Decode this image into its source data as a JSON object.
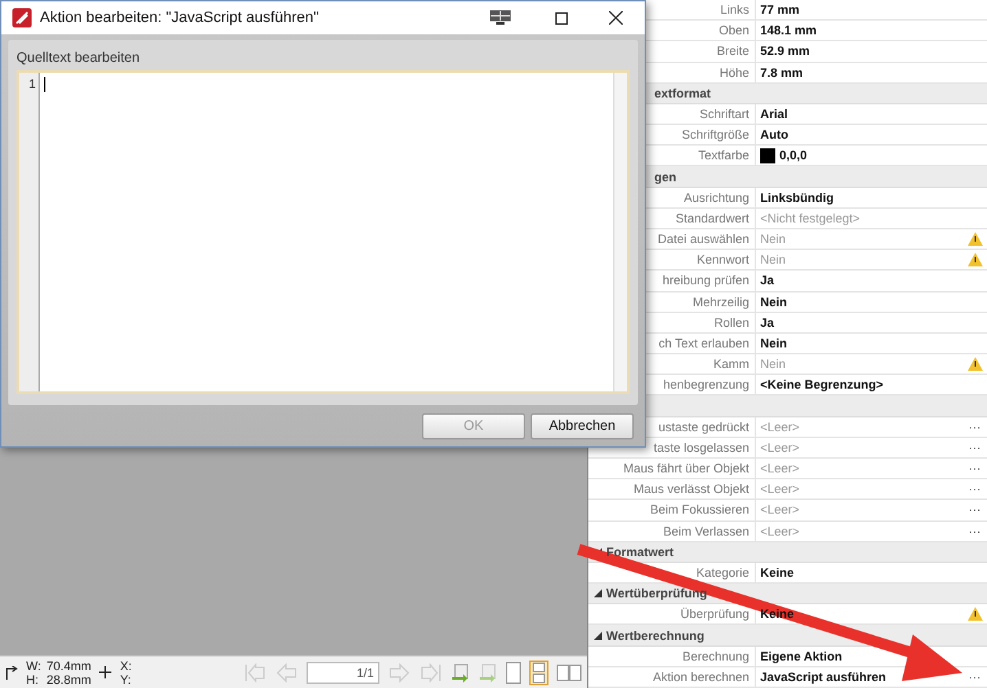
{
  "dialog": {
    "title": "Aktion bearbeiten: \"JavaScript ausführen\"",
    "editor_label": "Quelltext bearbeiten",
    "line_numbers": [
      "1"
    ],
    "buttons": [
      {
        "label": "OK",
        "disabled": true
      },
      {
        "label": "Abbrechen",
        "disabled": false
      }
    ]
  },
  "properties": [
    {
      "kind": "property",
      "label": "Links",
      "value": "77 mm",
      "dimmed": false,
      "warning": false
    },
    {
      "kind": "property",
      "label": "Oben",
      "value": "148.1 mm",
      "dimmed": false,
      "warning": false
    },
    {
      "kind": "property",
      "label": "Breite",
      "value": "52.9 mm",
      "dimmed": false,
      "warning": false
    },
    {
      "kind": "property",
      "label": "Höhe",
      "value": "7.8 mm",
      "dimmed": false,
      "warning": false
    },
    {
      "kind": "section",
      "title": "extformat"
    },
    {
      "kind": "property",
      "label": "Schriftart",
      "value": "Arial",
      "dimmed": false,
      "warning": false
    },
    {
      "kind": "property",
      "label": "Schriftgröße",
      "value": "Auto",
      "dimmed": false,
      "warning": false
    },
    {
      "kind": "property",
      "label": "Textfarbe",
      "value": "0,0,0",
      "color": "#000000",
      "dimmed": false,
      "warning": false
    },
    {
      "kind": "section",
      "title": "gen"
    },
    {
      "kind": "property",
      "label": "Ausrichtung",
      "value": "Linksbündig",
      "dimmed": false,
      "warning": false
    },
    {
      "kind": "property",
      "label": "Standardwert",
      "value": "<Nicht festgelegt>",
      "dimmed": true,
      "warning": false
    },
    {
      "kind": "property",
      "label": "Datei auswählen",
      "value": "Nein",
      "dimmed": true,
      "warning": true
    },
    {
      "kind": "property",
      "label": "Kennwort",
      "value": "Nein",
      "dimmed": true,
      "warning": true
    },
    {
      "kind": "property",
      "label": "hreibung prüfen",
      "value": "Ja",
      "dimmed": false,
      "warning": false
    },
    {
      "kind": "property",
      "label": "Mehrzeilig",
      "value": "Nein",
      "dimmed": false,
      "warning": false
    },
    {
      "kind": "property",
      "label": "Rollen",
      "value": "Ja",
      "dimmed": false,
      "warning": false
    },
    {
      "kind": "property",
      "label": "ch Text erlauben",
      "value": "Nein",
      "dimmed": false,
      "warning": false
    },
    {
      "kind": "property",
      "label": "Kamm",
      "value": "Nein",
      "dimmed": true,
      "warning": true
    },
    {
      "kind": "property",
      "label": "henbegrenzung",
      "value": "<Keine Begrenzung>",
      "dimmed": false,
      "warning": false
    },
    {
      "kind": "section"
    },
    {
      "kind": "property",
      "label": "ustaste gedrückt",
      "value": "<Leer>",
      "dimmed": true,
      "warning": false,
      "button": "···"
    },
    {
      "kind": "property",
      "label": "taste losgelassen",
      "value": "<Leer>",
      "dimmed": true,
      "warning": false,
      "button": "···"
    },
    {
      "kind": "property",
      "label": "Maus fährt über Objekt",
      "value": "<Leer>",
      "dimmed": true,
      "warning": false,
      "button": "···"
    },
    {
      "kind": "property",
      "label": "Maus verlässt Objekt",
      "value": "<Leer>",
      "dimmed": true,
      "warning": false,
      "button": "···"
    },
    {
      "kind": "property",
      "label": "Beim Fokussieren",
      "value": "<Leer>",
      "dimmed": true,
      "warning": false,
      "button": "···"
    },
    {
      "kind": "property",
      "label": "Beim Verlassen",
      "value": "<Leer>",
      "dimmed": true,
      "warning": false,
      "button": "···"
    },
    {
      "kind": "section",
      "title": "Formatwert",
      "expanded": true
    },
    {
      "kind": "property",
      "label": "Kategorie",
      "value": "Keine",
      "dimmed": false,
      "warning": false
    },
    {
      "kind": "section",
      "title": "Wertüberprüfung",
      "expanded": true
    },
    {
      "kind": "property",
      "label": "Überprüfung",
      "value": "Keine",
      "dimmed": false,
      "warning": true
    },
    {
      "kind": "section",
      "title": "Wertberechnung",
      "expanded": true
    },
    {
      "kind": "property",
      "label": "Berechnung",
      "value": "Eigene Aktion",
      "dimmed": false,
      "warning": false
    },
    {
      "kind": "property",
      "label": "Aktion berechnen",
      "value": "JavaScript ausführen",
      "dimmed": false,
      "warning": false,
      "button": "···"
    }
  ],
  "status_bar": {
    "w_label": "W:",
    "w": "70.4mm",
    "h_label": "H:",
    "h": "28.8mm",
    "x_label": "X:",
    "y_label": "Y:",
    "page": "1/1"
  }
}
